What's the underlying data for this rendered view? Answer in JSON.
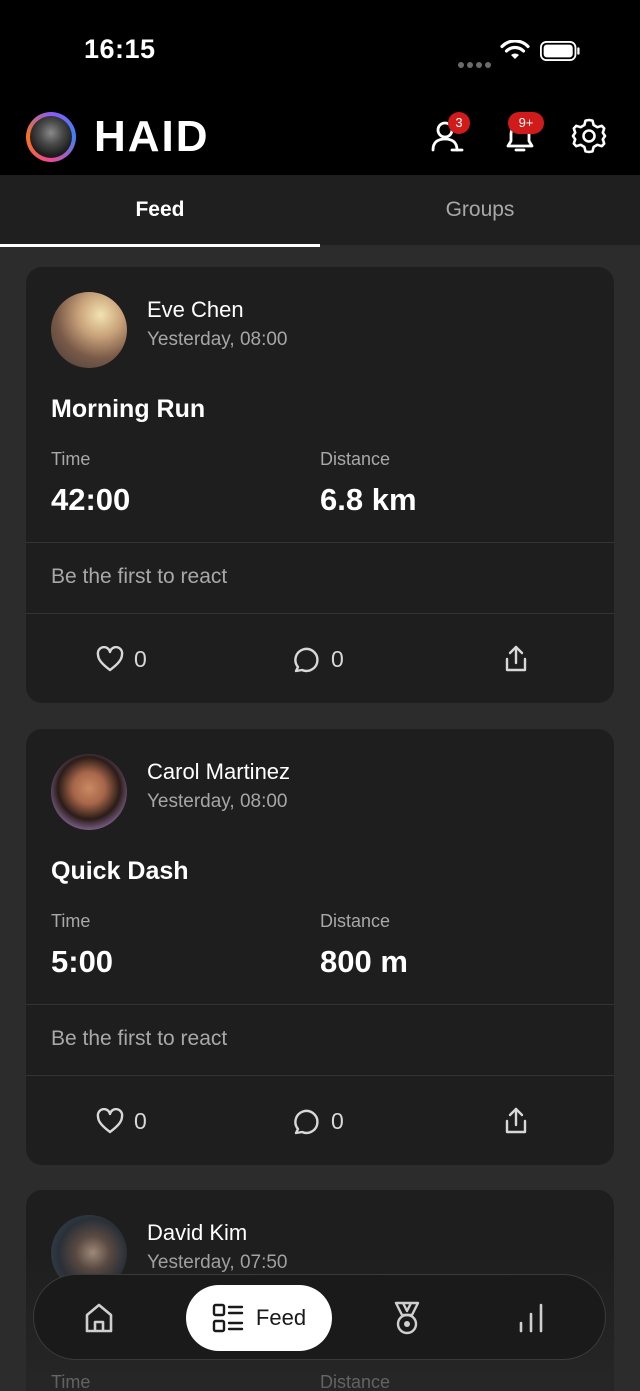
{
  "status_bar": {
    "time": "16:15"
  },
  "header": {
    "logo": "HAID",
    "friends_badge": "3",
    "notifications_badge": "9+"
  },
  "tabs": [
    {
      "label": "Feed",
      "active": true
    },
    {
      "label": "Groups",
      "active": false
    }
  ],
  "feed": [
    {
      "name": "Eve Chen",
      "date": "Yesterday, 08:00",
      "title": "Morning Run",
      "time_label": "Time",
      "time_value": "42:00",
      "distance_label": "Distance",
      "distance_value": "6.8 km",
      "reaction_prompt": "Be the first to react",
      "likes": "0",
      "comments": "0"
    },
    {
      "name": "Carol Martinez",
      "date": "Yesterday, 08:00",
      "title": "Quick Dash",
      "time_label": "Time",
      "time_value": "5:00",
      "distance_label": "Distance",
      "distance_value": "800 m",
      "reaction_prompt": "Be the first to react",
      "likes": "0",
      "comments": "0"
    },
    {
      "name": "David Kim",
      "date": "Yesterday, 07:50",
      "time_label": "Time",
      "distance_label": "Distance"
    }
  ],
  "bottom_nav": {
    "items": [
      {
        "icon": "home-icon"
      },
      {
        "icon": "feed-icon",
        "label": "Feed",
        "active": true
      },
      {
        "icon": "medal-icon"
      },
      {
        "icon": "stats-icon"
      }
    ]
  },
  "colors": {
    "background": "#2c2c2c",
    "card": "#1e1e1e",
    "badge": "#d11a1a"
  }
}
